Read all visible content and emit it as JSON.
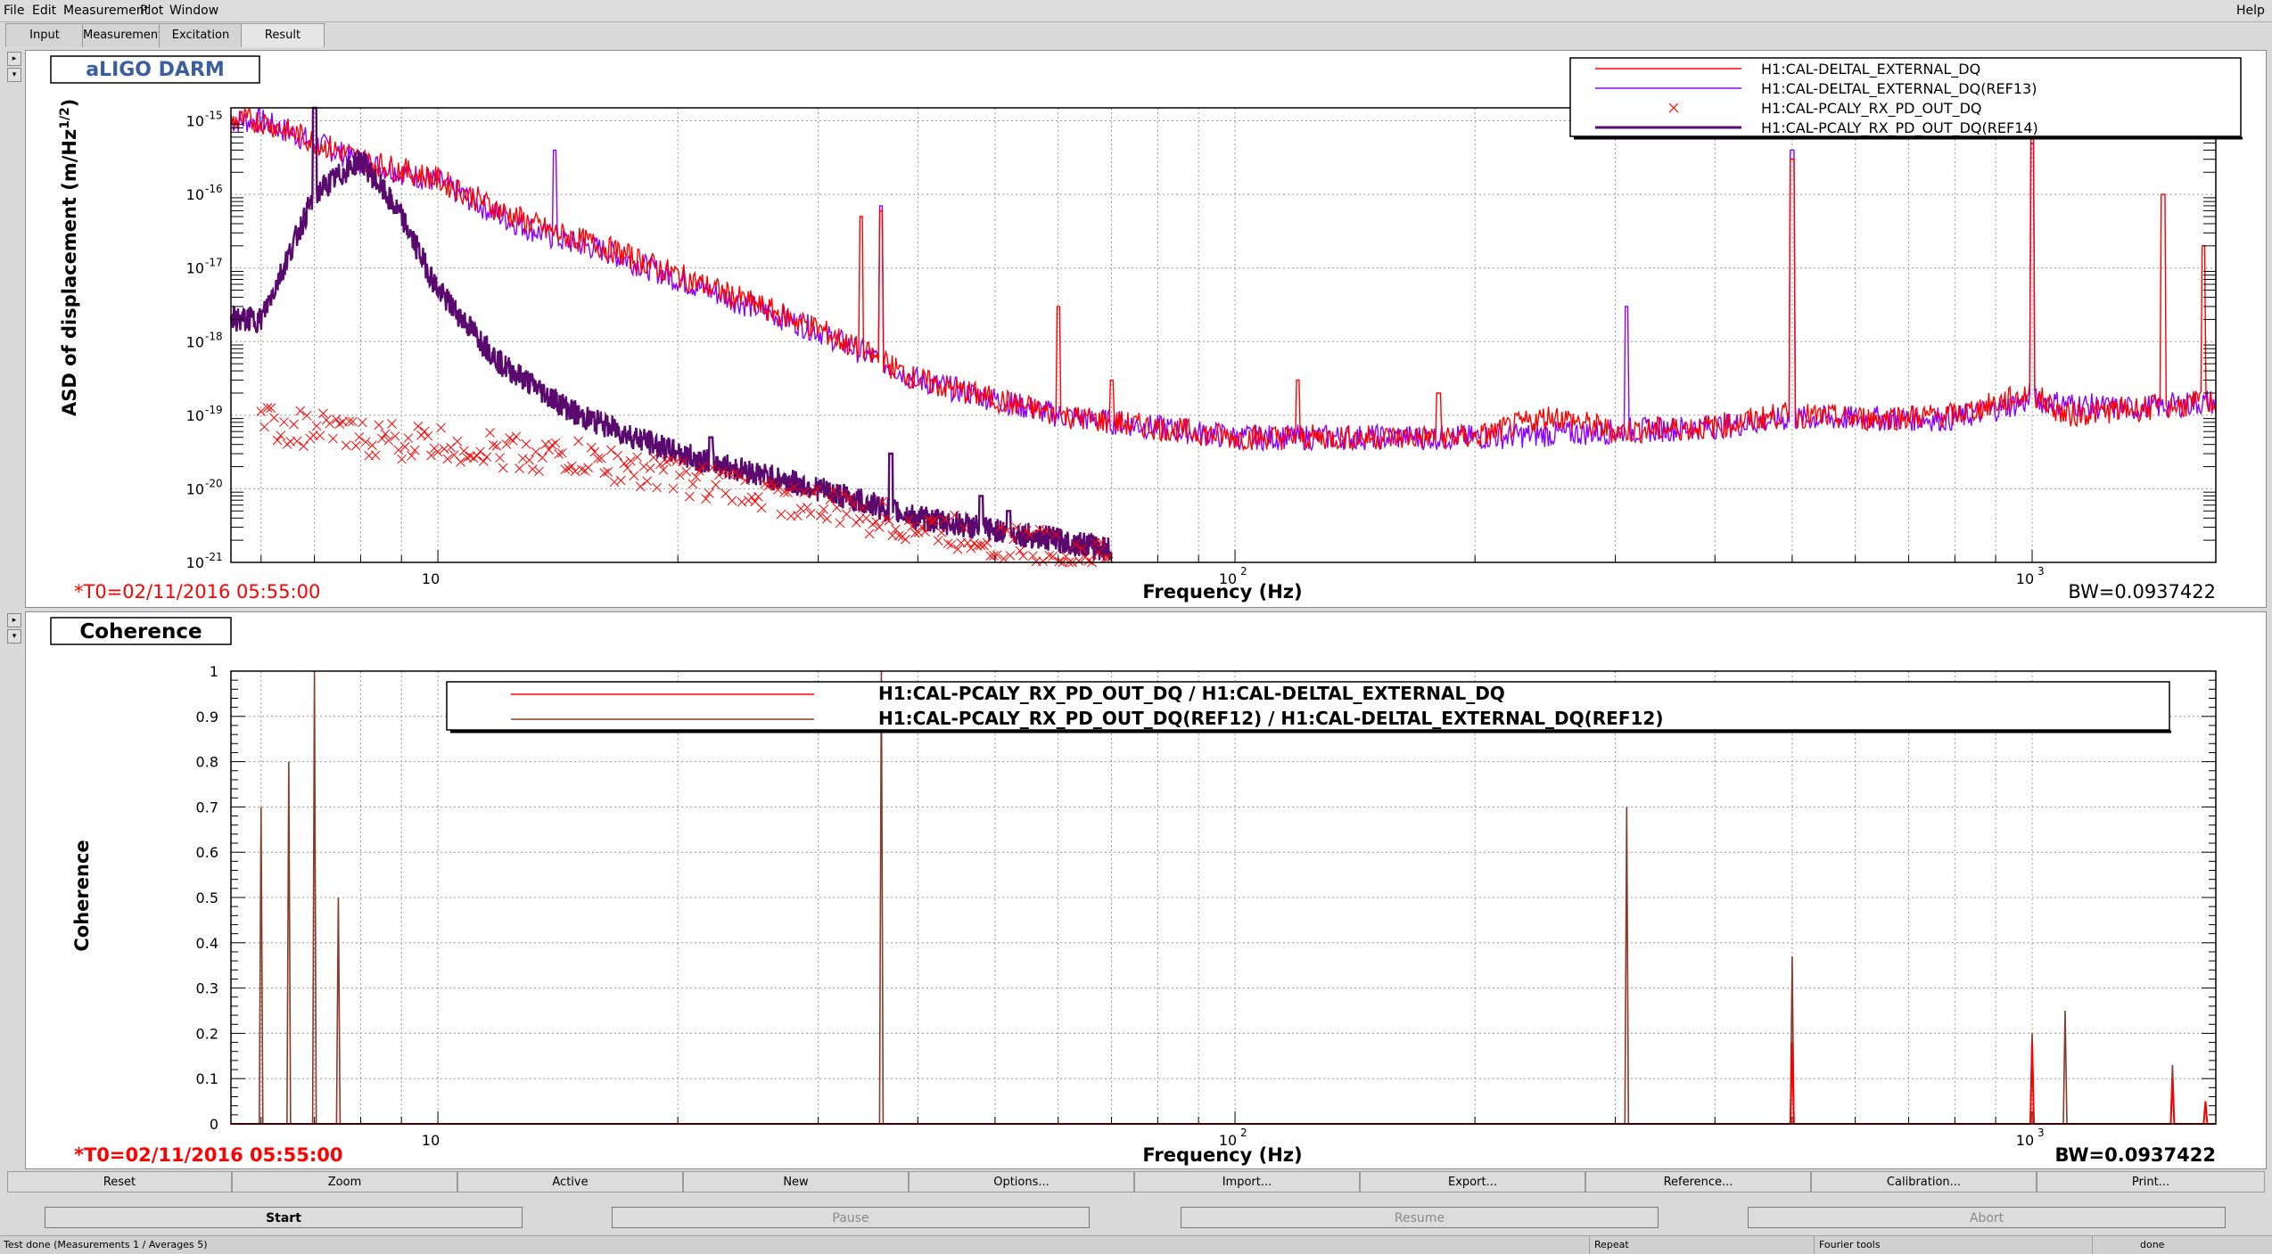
{
  "menu": {
    "file": "File",
    "edit": "Edit",
    "measurement": "Measurement",
    "plot": "Plot",
    "window": "Window",
    "help": "Help"
  },
  "tabs": [
    {
      "label": "Input"
    },
    {
      "label": "Measurement"
    },
    {
      "label": "Excitation"
    },
    {
      "label": "Result"
    }
  ],
  "plot1": {
    "title": "aLIGO DARM",
    "ylabel": "ASD of displacement (m/Hz",
    "ylabel_sup": "1/2",
    "ylabel_close": ")",
    "xlabel": "Frequency (Hz)",
    "t0": "*T0=02/11/2016 05:55:00",
    "bw": "BW=0.0937422",
    "yticks": [
      "10",
      "10",
      "10",
      "10",
      "10",
      "10",
      "10"
    ],
    "yexp": [
      "-15",
      "-16",
      "-17",
      "-18",
      "-19",
      "-20",
      "-21"
    ],
    "xticks": [
      "10",
      "10",
      "10"
    ],
    "xexp": [
      "",
      "2",
      "3"
    ],
    "legend": [
      {
        "label": "H1:CAL-DELTAL_EXTERNAL_DQ",
        "color": "#ff0000"
      },
      {
        "label": "H1:CAL-DELTAL_EXTERNAL_DQ(REF13)",
        "color": "#8b00ff"
      },
      {
        "label": "H1:CAL-PCALY_RX_PD_OUT_DQ",
        "color": "#ff0000"
      },
      {
        "label": "H1:CAL-PCALY_RX_PD_OUT_DQ(REF14)",
        "color": "#5a0a6e"
      }
    ]
  },
  "plot2": {
    "title": "Coherence",
    "ylabel": "Coherence",
    "xlabel": "Frequency (Hz)",
    "t0": "*T0=02/11/2016 05:55:00",
    "bw": "BW=0.0937422",
    "yticks": [
      "1",
      "0.9",
      "0.8",
      "0.7",
      "0.6",
      "0.5",
      "0.4",
      "0.3",
      "0.2",
      "0.1",
      "0"
    ],
    "xticks": [
      "10",
      "10",
      "10"
    ],
    "xexp": [
      "",
      "2",
      "3"
    ],
    "legend": [
      {
        "label": "H1:CAL-PCALY_RX_PD_OUT_DQ / H1:CAL-DELTAL_EXTERNAL_DQ",
        "color": "#ff0000"
      },
      {
        "label": "H1:CAL-PCALY_RX_PD_OUT_DQ(REF12) / H1:CAL-DELTAL_EXTERNAL_DQ(REF12)",
        "color": "#8b3a2a"
      }
    ]
  },
  "toolbar": {
    "reset": "Reset",
    "zoom": "Zoom",
    "active": "Active",
    "new": "New",
    "options": "Options...",
    "import": "Import...",
    "export": "Export...",
    "reference": "Reference...",
    "calibration": "Calibration...",
    "print": "Print..."
  },
  "run": {
    "start": "Start",
    "pause": "Pause",
    "resume": "Resume",
    "abort": "Abort"
  },
  "status": {
    "msg": "Test done (Measurements 1 / Averages 5)",
    "repeat": "Repeat",
    "fourier": "Fourier tools",
    "done": "done"
  },
  "colors": {
    "live": "#ff0000",
    "ref13": "#8b00ff",
    "ref14": "#5a0a6e",
    "coh_ref": "#8b3a2a"
  },
  "chart_data": [
    {
      "type": "line",
      "title": "aLIGO DARM",
      "xlabel": "Frequency (Hz)",
      "ylabel": "ASD of displacement (m/Hz^1/2)",
      "xscale": "log",
      "yscale": "log",
      "xlim": [
        5.5,
        1700
      ],
      "ylim": [
        1e-21,
        1.5e-15
      ],
      "grid": true,
      "legend": "top-right",
      "series": [
        {
          "name": "H1:CAL-DELTAL_EXTERNAL_DQ",
          "x": [
            6,
            8,
            10,
            12,
            14,
            16,
            20,
            30,
            40,
            60,
            100,
            200,
            250,
            300,
            400,
            480,
            500,
            600,
            800,
            1000,
            1100,
            1300,
            1500,
            1650
          ],
          "y": [
            1e-15,
            3e-16,
            1.6e-16,
            6e-17,
            3e-17,
            2e-17,
            8e-18,
            1.5e-18,
            3e-19,
            1e-19,
            5e-20,
            5e-20,
            1e-19,
            6e-20,
            7e-20,
            1e-19,
            1e-19,
            9e-20,
            1e-19,
            2e-19,
            1e-19,
            1.2e-19,
            1.3e-19,
            1.5e-19
          ]
        },
        {
          "name": "H1:CAL-DELTAL_EXTERNAL_DQ(REF13)",
          "x": [
            6,
            8,
            10,
            12,
            14,
            16,
            20,
            30,
            40,
            60,
            100,
            200,
            300,
            400,
            500,
            800,
            1000,
            1300,
            1650
          ],
          "y": [
            1e-15,
            2.8e-16,
            1.5e-16,
            5e-17,
            2.5e-17,
            1.8e-17,
            7e-18,
            1.4e-18,
            3e-19,
            1e-19,
            5e-20,
            5e-20,
            6e-20,
            7e-20,
            9e-20,
            9e-20,
            1.6e-19,
            1.2e-19,
            1.5e-19
          ]
        },
        {
          "name": "H1:CAL-PCALY_RX_PD_OUT_DQ",
          "x": [
            6,
            8,
            10,
            15,
            20,
            30,
            40,
            50,
            60,
            70
          ],
          "y": [
            8e-20,
            5e-20,
            4e-20,
            2.5e-20,
            1.5e-20,
            6e-21,
            3e-21,
            2e-21,
            1.5e-21,
            1.2e-21
          ]
        },
        {
          "name": "H1:CAL-PCALY_RX_PD_OUT_DQ(REF14)",
          "x": [
            6,
            7,
            8,
            9,
            10,
            12,
            15,
            20,
            30,
            40,
            60,
            70
          ],
          "y": [
            2e-18,
            1e-16,
            3e-16,
            5e-17,
            5e-18,
            5e-19,
            1e-19,
            3e-20,
            1e-20,
            4e-21,
            2e-21,
            1.5e-21
          ]
        }
      ]
    },
    {
      "type": "line",
      "title": "Coherence",
      "xlabel": "Frequency (Hz)",
      "ylabel": "Coherence",
      "xscale": "log",
      "xlim": [
        5.5,
        1700
      ],
      "ylim": [
        0,
        1
      ],
      "grid": true,
      "legend": "top",
      "series": [
        {
          "name": "H1:CAL-PCALY_RX_PD_OUT_DQ / H1:CAL-DELTAL_EXTERNAL_DQ",
          "x": [
            6,
            100,
            500,
            510,
            1000,
            1010,
            1500,
            1650
          ],
          "y": [
            0,
            0,
            0.18,
            0,
            0.18,
            0,
            0.1,
            0.05
          ]
        },
        {
          "name": "H1:CAL-PCALY_RX_PD_OUT_DQ(REF12) / H1:CAL-DELTAL_EXTERNAL_DQ(REF12)",
          "x": [
            6,
            6.5,
            7,
            7.5,
            8,
            36,
            36.5,
            310,
            500,
            510,
            1000,
            1100,
            1500
          ],
          "y": [
            0.7,
            0.8,
            1,
            0.5,
            0,
            1,
            0,
            0.7,
            0.37,
            0,
            0.2,
            0.25,
            0.13
          ]
        }
      ]
    }
  ]
}
